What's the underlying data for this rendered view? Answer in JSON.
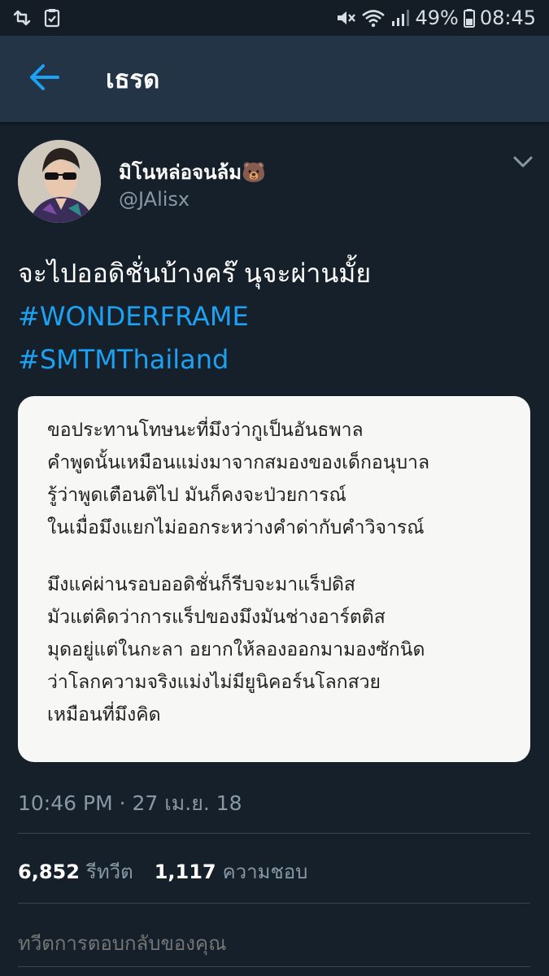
{
  "status_bar": {
    "battery": "49%",
    "time": "08:45",
    "icons": [
      "retweet-notification-icon",
      "checklist-icon",
      "mute-icon",
      "wifi-icon",
      "signal-icon",
      "battery-icon"
    ]
  },
  "header": {
    "title": "เธรด",
    "back_icon": "arrow-left-icon"
  },
  "tweet": {
    "author_name": "มิโนหล่อจนล้ม🐻",
    "author_handle": "@JAlisx",
    "text_line1": "จะไปออดิชั่นบ้างคร๊ นุจะผ่านมั้ย",
    "hashtag1": "#WONDERFRAME",
    "hashtag2": "#SMTMThailand",
    "image_text": {
      "para1": [
        "ขอประทานโทษนะที่มึงว่ากูเป็นอันธพาล",
        "คำพูดนั้นเหมือนแม่งมาจากสมองของเด็กอนุบาล",
        "รู้ว่าพูดเตือนติไป มันก็คงจะป่วยการณ์",
        "ในเมื่อมึงแยกไม่ออกระหว่างคำด่ากับคำวิจารณ์"
      ],
      "para2": [
        "มึงแค่ผ่านรอบออดิชั่นก็รีบจะมาแร็ปดิส",
        "มัวแต่คิดว่าการแร็ปของมึงมันช่างอาร์ตติส",
        "มุดอยู่แต่ในกะลา อยากให้ลองออกมามองซักนิด",
        "ว่าโลกความจริงแม่งไม่มียูนิคอร์นโลกสวย",
        "เหมือนที่มึงคิด"
      ]
    },
    "timestamp": "10:46 PM · 27 เม.ย. 18",
    "retweets_count": "6,852",
    "retweets_label": "รีทวีต",
    "likes_count": "1,117",
    "likes_label": "ความชอบ"
  },
  "reply": {
    "placeholder": "ทวีตการตอบกลับของคุณ"
  },
  "colors": {
    "background": "#15202b",
    "header": "#243447",
    "accent": "#1da1f2",
    "secondary_text": "#8899a6"
  }
}
